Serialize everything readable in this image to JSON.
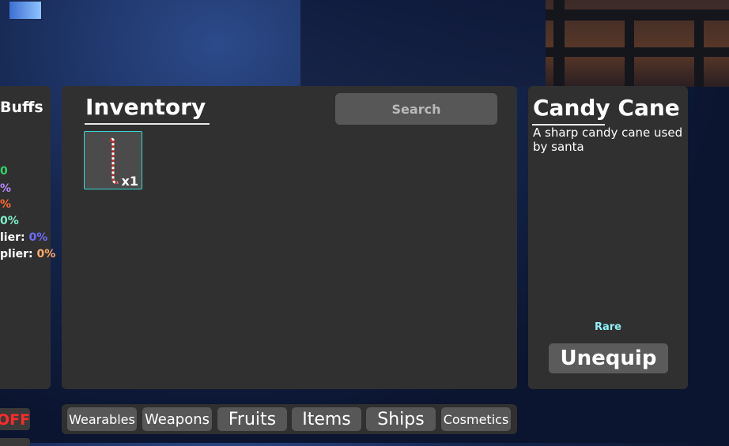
{
  "buffs": {
    "title": "Buffs",
    "lines": [
      {
        "text": "0",
        "color": "#34d16b"
      },
      {
        "text": "%",
        "color": "#b886ff"
      },
      {
        "text": "%",
        "color": "#ff6a2a"
      },
      {
        "text": "0%",
        "color": "#7ff0c8"
      },
      {
        "label": "lier: ",
        "value": "0%",
        "value_color": "#6e6bff"
      },
      {
        "label": "plier: ",
        "value": "0%",
        "value_color": "#ffab6b"
      }
    ]
  },
  "inventory": {
    "title": "Inventory",
    "search_placeholder": "Search",
    "items": [
      {
        "name": "Candy Cane",
        "icon": "candy-cane-icon",
        "quantity": "x1",
        "selected": true
      }
    ]
  },
  "details": {
    "title": "Candy Cane",
    "description": "A sharp candy cane used by santa",
    "rarity": "Rare",
    "action_label": "Unequip"
  },
  "tabs": [
    {
      "label": "Wearables"
    },
    {
      "label": "Weapons"
    },
    {
      "label": "Fruits"
    },
    {
      "label": "Items"
    },
    {
      "label": "Ships"
    },
    {
      "label": "Cosmetics"
    }
  ],
  "toggle": {
    "label": "OFF",
    "color": "#ff2a2a"
  }
}
